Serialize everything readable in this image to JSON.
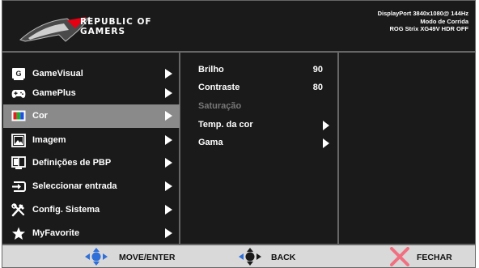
{
  "brand": {
    "line1": "REPUBLIC OF",
    "line2": "GAMERS"
  },
  "status": {
    "line1": "DisplayPort 3840x1080@ 144Hz",
    "line2": "Modo de Corrida",
    "line3": "ROG Strix XG49V HDR OFF"
  },
  "menu": {
    "items": [
      {
        "label": "GameVisual",
        "icon": "gamevisual-icon"
      },
      {
        "label": "GamePlus",
        "icon": "gamepad-icon"
      },
      {
        "label": "Cor",
        "icon": "color-icon",
        "selected": true
      },
      {
        "label": "Imagem",
        "icon": "image-icon"
      },
      {
        "label": "Definições de PBP",
        "icon": "pbp-icon"
      },
      {
        "label": "Seleccionar entrada",
        "icon": "input-icon"
      },
      {
        "label": "Config. Sistema",
        "icon": "tools-icon"
      },
      {
        "label": "MyFavorite",
        "icon": "star-icon"
      }
    ]
  },
  "submenu": {
    "items": [
      {
        "label": "Brilho",
        "value": "90"
      },
      {
        "label": "Contraste",
        "value": "80"
      },
      {
        "label": "Saturação",
        "disabled": true
      },
      {
        "label": "Temp. da cor",
        "has_arrow": true
      },
      {
        "label": "Gama",
        "has_arrow": true
      }
    ]
  },
  "footer": {
    "move_label": "MOVE/ENTER",
    "back_label": "BACK",
    "close_label": "FECHAR"
  },
  "colors": {
    "background": "#1a1a1a",
    "selected": "#8a8a8a",
    "footer": "#d9d9d9",
    "joystick": "#2f6fd8",
    "close": "#f07080",
    "logo": "#e60012"
  }
}
